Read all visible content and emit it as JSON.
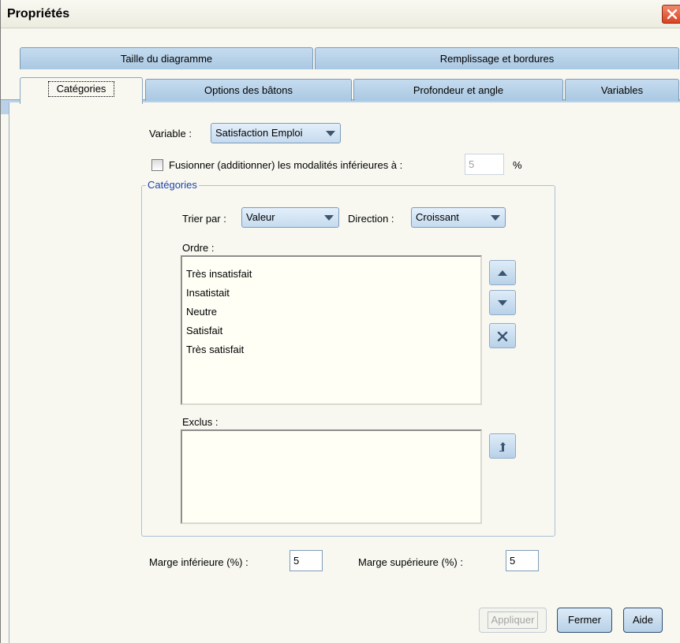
{
  "window": {
    "title": "Propriétés"
  },
  "tabs_back": [
    {
      "label": "Taille du diagramme"
    },
    {
      "label": "Remplissage et bordures"
    }
  ],
  "tabs_front": [
    {
      "label": "Catégories"
    },
    {
      "label": "Options des bâtons"
    },
    {
      "label": "Profondeur et angle"
    },
    {
      "label": "Variables"
    }
  ],
  "variable": {
    "label": "Variable :",
    "value": "Satisfaction Emploi"
  },
  "merge": {
    "label": "Fusionner (additionner) les modalités inférieures à :",
    "value": "5",
    "unit": "%",
    "checked": false
  },
  "categories_group": {
    "title": "Catégories",
    "sort_label": "Trier par :",
    "sort_value": "Valeur",
    "direction_label": "Direction :",
    "direction_value": "Croissant",
    "order_label": "Ordre :",
    "order_items": [
      "Très insatisfait",
      "Insatistait",
      "Neutre",
      "Satisfait",
      "Très satisfait"
    ],
    "excluded_label": "Exclus :",
    "excluded_items": []
  },
  "margins": {
    "lower_label": "Marge inférieure (%) :",
    "lower_value": "5",
    "upper_label": "Marge supérieure (%) :",
    "upper_value": "5"
  },
  "buttons": {
    "apply": "Appliquer",
    "close": "Fermer",
    "help": "Aide"
  },
  "icons": {
    "move_up": "triangle-up-icon",
    "move_down": "triangle-down-icon",
    "remove": "x-icon",
    "restore": "restore-arrow-icon",
    "close": "close-icon"
  }
}
